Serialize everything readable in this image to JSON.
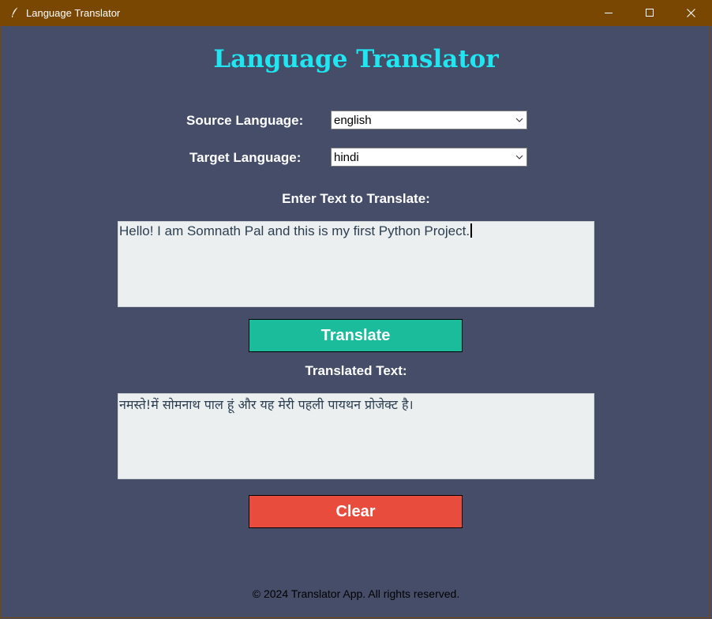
{
  "window": {
    "title": "Language Translator",
    "icon": "feather-icon",
    "controls": [
      "minimize-icon",
      "maximize-icon",
      "close-icon"
    ]
  },
  "app": {
    "heading": "Language Translator",
    "source_label": "Source Language:",
    "source_value": "english",
    "target_label": "Target Language:",
    "target_value": "hindi",
    "input_label": "Enter Text to Translate:",
    "input_text": "Hello! I am Somnath Pal and this is my first Python Project.",
    "translate_button": "Translate",
    "output_label": "Translated Text:",
    "output_text": "नमस्ते!में सोमनाथ पाल हूं और यह मेरी पहली पायथन प्रोजेक्ट है।",
    "clear_button": "Clear",
    "footer": "© 2024 Translator App. All rights reserved."
  },
  "colors": {
    "titlebar": "#7a4703",
    "background": "#454d69",
    "heading": "#1fe6f0",
    "translate_button": "#1abc9c",
    "clear_button": "#e74c3c",
    "textbox": "#ebeff0"
  }
}
